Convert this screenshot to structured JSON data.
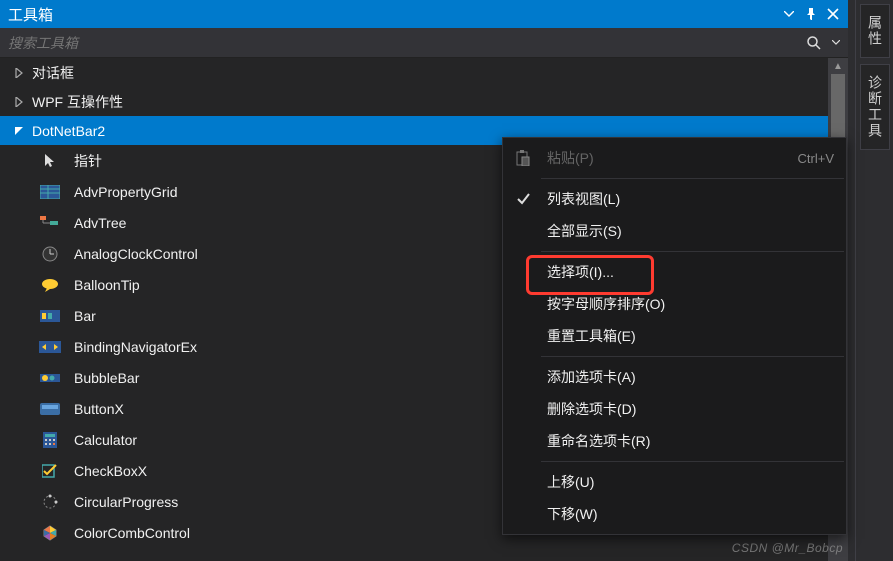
{
  "panel": {
    "title": "工具箱"
  },
  "search": {
    "placeholder": "搜索工具箱"
  },
  "groups": [
    {
      "label": "对话框",
      "expanded": false,
      "selected": false
    },
    {
      "label": "WPF 互操作性",
      "expanded": false,
      "selected": false
    },
    {
      "label": "DotNetBar2",
      "expanded": true,
      "selected": true
    }
  ],
  "items": [
    {
      "label": "指针",
      "icon": "pointer"
    },
    {
      "label": "AdvPropertyGrid",
      "icon": "grid"
    },
    {
      "label": "AdvTree",
      "icon": "tree"
    },
    {
      "label": "AnalogClockControl",
      "icon": "clock"
    },
    {
      "label": "BalloonTip",
      "icon": "balloon"
    },
    {
      "label": "Bar",
      "icon": "bar"
    },
    {
      "label": "BindingNavigatorEx",
      "icon": "nav"
    },
    {
      "label": "BubbleBar",
      "icon": "bubble"
    },
    {
      "label": "ButtonX",
      "icon": "button"
    },
    {
      "label": "Calculator",
      "icon": "calc"
    },
    {
      "label": "CheckBoxX",
      "icon": "check"
    },
    {
      "label": "CircularProgress",
      "icon": "circle"
    },
    {
      "label": "ColorCombControl",
      "icon": "color"
    }
  ],
  "contextMenu": {
    "items": [
      {
        "label": "粘贴(P)",
        "shortcut": "Ctrl+V",
        "icon": "paste",
        "disabled": true
      },
      {
        "sep": true
      },
      {
        "label": "列表视图(L)",
        "icon": "check",
        "disabled": false
      },
      {
        "label": "全部显示(S)",
        "disabled": false
      },
      {
        "sep": true
      },
      {
        "label": "选择项(I)...",
        "disabled": false,
        "highlighted": true
      },
      {
        "label": "按字母顺序排序(O)",
        "disabled": false
      },
      {
        "label": "重置工具箱(E)",
        "disabled": false
      },
      {
        "sep": true
      },
      {
        "label": "添加选项卡(A)",
        "disabled": false
      },
      {
        "label": "删除选项卡(D)",
        "disabled": false
      },
      {
        "label": "重命名选项卡(R)",
        "disabled": false
      },
      {
        "sep": true
      },
      {
        "label": "上移(U)",
        "disabled": false
      },
      {
        "label": "下移(W)",
        "disabled": false
      }
    ]
  },
  "sideTabs": [
    {
      "label": "属性"
    },
    {
      "label": "诊断工具"
    }
  ],
  "watermark": "CSDN @Mr_Bobcp"
}
